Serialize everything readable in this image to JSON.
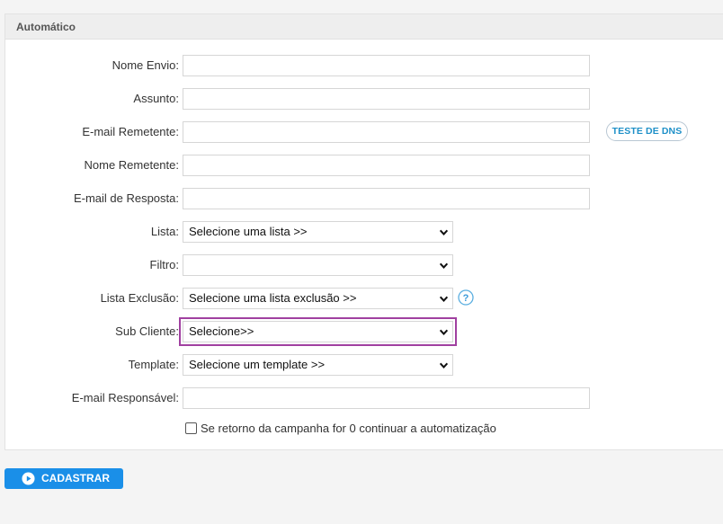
{
  "panel": {
    "title": "Automático"
  },
  "fields": {
    "nome_envio": {
      "label": "Nome Envio:",
      "value": ""
    },
    "assunto": {
      "label": "Assunto:",
      "value": ""
    },
    "email_remetente": {
      "label": "E-mail Remetente:",
      "value": ""
    },
    "nome_remetente": {
      "label": "Nome Remetente:",
      "value": ""
    },
    "email_resposta": {
      "label": "E-mail de Resposta:",
      "value": ""
    },
    "lista": {
      "label": "Lista:",
      "selected": "Selecione uma lista >>"
    },
    "filtro": {
      "label": "Filtro:",
      "selected": ""
    },
    "lista_exclusao": {
      "label": "Lista Exclusão:",
      "selected": "Selecione uma lista exclusão >>"
    },
    "sub_cliente": {
      "label": "Sub Cliente:",
      "selected": "Selecione>>"
    },
    "template": {
      "label": "Template:",
      "selected": "Selecione um template >>"
    },
    "email_responsavel": {
      "label": "E-mail Responsável:",
      "value": ""
    }
  },
  "dns_button": {
    "label": "TESTE DE DNS"
  },
  "help_icon": {
    "glyph": "?",
    "icon": "question-circle-icon"
  },
  "checkbox": {
    "label": "Se retorno da campanha for 0 continuar a automatização",
    "checked": false
  },
  "submit": {
    "label": "CADASTRAR",
    "icon": "play-circle-icon"
  },
  "colors": {
    "accent": "#1a8fe8",
    "highlight": "#a040a0",
    "link": "#1e90c8"
  }
}
